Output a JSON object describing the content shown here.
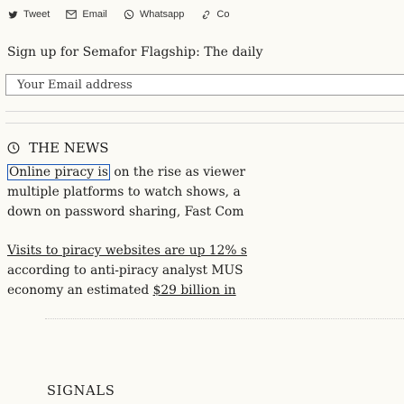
{
  "top_crumb": "",
  "share": {
    "tweet": "Tweet",
    "email": "Email",
    "whatsapp": "Whatsapp",
    "copy": "Co"
  },
  "signup": {
    "text": "Sign up for Semafor Flagship: The daily",
    "email_placeholder": "Your Email address"
  },
  "news": {
    "header": "THE NEWS",
    "p1_hl": "Online piracy is",
    "p1_rest": " on the rise as viewer",
    "p1_line2": "multiple platforms to watch shows, a",
    "p1_line3": "down on password sharing, Fast Com",
    "p2_link1": "Visits to piracy websites are up 12% s",
    "p2_line2_pre": "according to anti-piracy analyst MUS",
    "p2_line3_pre": "economy an estimated ",
    "p2_line3_link": "$29 billion in"
  },
  "signals": "SIGNALS"
}
